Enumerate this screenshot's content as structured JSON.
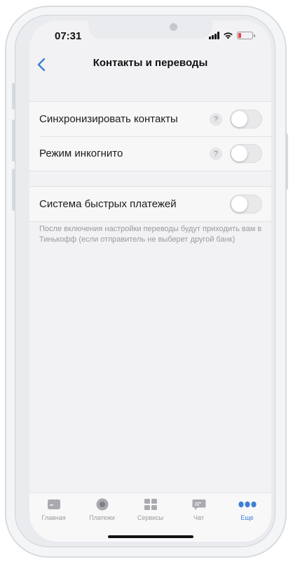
{
  "status_bar": {
    "time": "07:31",
    "battery_level": 0.2,
    "icons": [
      "signal-icon",
      "wifi-icon",
      "battery-icon"
    ]
  },
  "nav": {
    "title": "Контакты и переводы",
    "back_icon": "chevron-left-icon"
  },
  "settings": {
    "group1": [
      {
        "label": "Синхронизировать контакты",
        "help": "?",
        "enabled": false
      },
      {
        "label": "Режим инкогнито",
        "help": "?",
        "enabled": false
      }
    ],
    "group2": [
      {
        "label": "Система быстрых платежей",
        "enabled": false
      }
    ],
    "footnote": "После включения настройки переводы будут приходить вам в Тинькофф (если отправитель не выберет другой банк)"
  },
  "tab_bar": {
    "items": [
      {
        "label": "Главная",
        "icon": "card-icon",
        "active": false
      },
      {
        "label": "Платежи",
        "icon": "circle-icon",
        "active": false
      },
      {
        "label": "Сервисы",
        "icon": "grid-icon",
        "active": false
      },
      {
        "label": "Чат",
        "icon": "chat-icon",
        "active": false
      },
      {
        "label": "Еще",
        "icon": "more-icon",
        "active": true
      }
    ]
  },
  "colors": {
    "accent": "#3d7fd6",
    "background": "#f2f2f4",
    "inactive": "#9a9aa0",
    "battery_low": "#e64646"
  }
}
